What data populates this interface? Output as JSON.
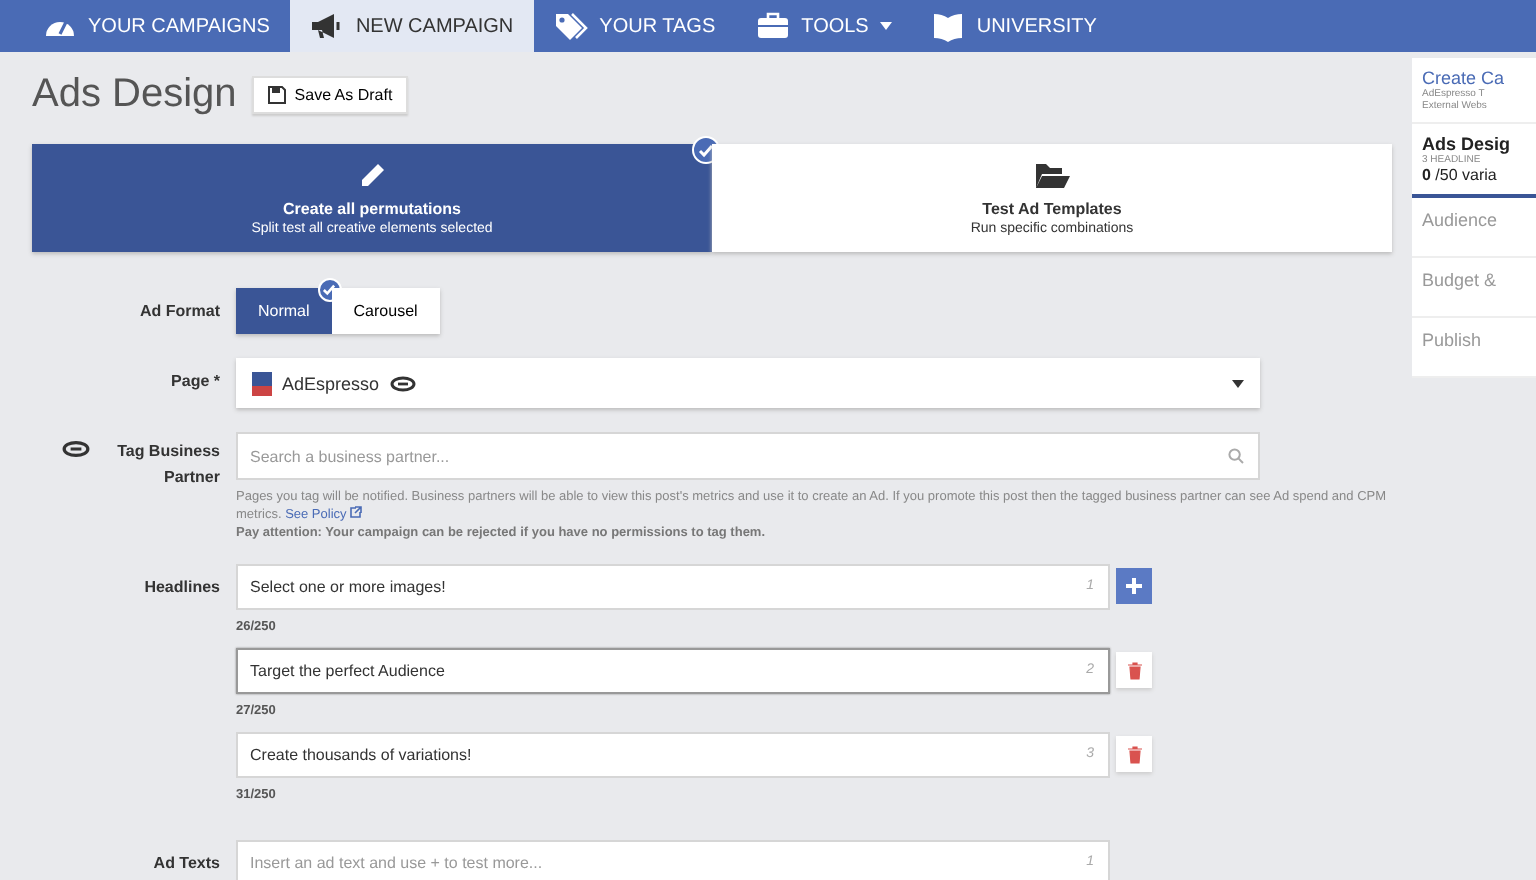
{
  "nav": [
    {
      "label": "YOUR CAMPAIGNS",
      "selected": false
    },
    {
      "label": "NEW CAMPAIGN",
      "selected": true
    },
    {
      "label": "YOUR TAGS",
      "selected": false
    },
    {
      "label": "TOOLS",
      "selected": false,
      "dropdown": true
    },
    {
      "label": "UNIVERSITY",
      "selected": false
    }
  ],
  "page_title": "Ads Design",
  "save_button": "Save As Draft",
  "modes": [
    {
      "title": "Create all permutations",
      "subtitle": "Split test all creative elements selected",
      "selected": true
    },
    {
      "title": "Test Ad Templates",
      "subtitle": "Run specific combinations",
      "selected": false
    }
  ],
  "ad_format": {
    "label": "Ad Format",
    "options": [
      {
        "label": "Normal",
        "selected": true
      },
      {
        "label": "Carousel",
        "selected": false
      }
    ]
  },
  "page_field": {
    "label": "Page *",
    "value": "AdEspresso"
  },
  "tag_partner": {
    "label": "Tag Business Partner",
    "placeholder": "Search a business partner...",
    "help": "Pages you tag will be notified. Business partners will be able to view this post's metrics and use it to create an Ad. If you promote this post then the tagged business partner can see Ad spend and CPM metrics.",
    "policy_link": "See Policy",
    "warning": "Pay attention: Your campaign can be rejected if you have no permissions to tag them."
  },
  "headlines": {
    "label": "Headlines",
    "items": [
      {
        "value": "Select one or more images!",
        "number": "1",
        "counter": "26/250",
        "kind": "add",
        "focused": false
      },
      {
        "value": "Target the perfect Audience",
        "number": "2",
        "counter": "27/250",
        "kind": "delete",
        "focused": true
      },
      {
        "value": "Create thousands of variations!",
        "number": "3",
        "counter": "31/250",
        "kind": "delete",
        "focused": false
      }
    ]
  },
  "ad_texts": {
    "label": "Ad Texts",
    "placeholder": "Insert an ad text and use + to test more...",
    "number": "1"
  },
  "sidebar": {
    "steps": [
      {
        "title": "Create Ca",
        "lines": [
          "AdEspresso T",
          "External Webs"
        ],
        "selected": false
      },
      {
        "title": "Ads Desig",
        "lines": [
          "3 HEADLINE"
        ],
        "variations": "**0** /50 varia",
        "selected": true
      },
      {
        "title": "Audience",
        "selected": false
      },
      {
        "title": "Budget &",
        "selected": false
      },
      {
        "title": "Publish",
        "selected": false
      }
    ]
  }
}
